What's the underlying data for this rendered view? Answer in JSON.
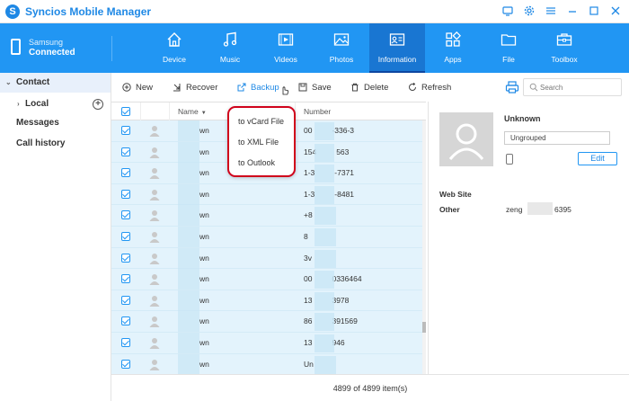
{
  "app": {
    "title": "Syncios Mobile Manager",
    "logo": "S"
  },
  "device": {
    "name": "Samsung",
    "status": "Connected"
  },
  "nav": [
    {
      "label": "Device",
      "icon": "home-icon"
    },
    {
      "label": "Music",
      "icon": "music-icon"
    },
    {
      "label": "Videos",
      "icon": "video-icon"
    },
    {
      "label": "Photos",
      "icon": "photo-icon"
    },
    {
      "label": "Information",
      "icon": "information-icon",
      "active": true
    },
    {
      "label": "Apps",
      "icon": "apps-icon"
    },
    {
      "label": "File",
      "icon": "folder-icon"
    },
    {
      "label": "Toolbox",
      "icon": "toolbox-icon"
    }
  ],
  "sidebar": {
    "contact": "Contact",
    "local": "Local",
    "messages": "Messages",
    "call_history": "Call history"
  },
  "toolbar": {
    "new": "New",
    "recover": "Recover",
    "backup": "Backup",
    "save": "Save",
    "delete": "Delete",
    "refresh": "Refresh",
    "search_placeholder": "Search"
  },
  "table": {
    "col_name": "Name",
    "col_number": "Number",
    "rows": [
      {
        "name": "wn",
        "number": "00",
        "number_tail": "-336-3"
      },
      {
        "name": "wn",
        "number": "154",
        "number_tail": "563"
      },
      {
        "name": "wn",
        "number": "1-3",
        "number_tail": "-7371"
      },
      {
        "name": "wn",
        "number": "1-3",
        "number_tail": "-8481"
      },
      {
        "name": "wn",
        "number": "+8",
        "number_tail": ""
      },
      {
        "name": "wn",
        "number": "8",
        "number_tail": ""
      },
      {
        "name": "wn",
        "number": "3v",
        "number_tail": ""
      },
      {
        "name": "wn",
        "number": "00",
        "number_tail": "0336464"
      },
      {
        "name": "wn",
        "number": "13",
        "number_tail": "3978"
      },
      {
        "name": "wn",
        "number": "86",
        "number_tail": "391569"
      },
      {
        "name": "wn",
        "number": "13",
        "number_tail": "946"
      },
      {
        "name": "wn",
        "number": "Un",
        "number_tail": ""
      }
    ]
  },
  "backup_menu": [
    "to vCard File",
    "to XML File",
    "to Outlook"
  ],
  "footer": {
    "count": "4899 of 4899 item(s)"
  },
  "details": {
    "name": "Unknown",
    "group": "Ungrouped",
    "edit": "Edit",
    "section_title": "Web Site",
    "field_label": "Other",
    "field_value_start": "zeng",
    "field_value_end": "6395"
  }
}
